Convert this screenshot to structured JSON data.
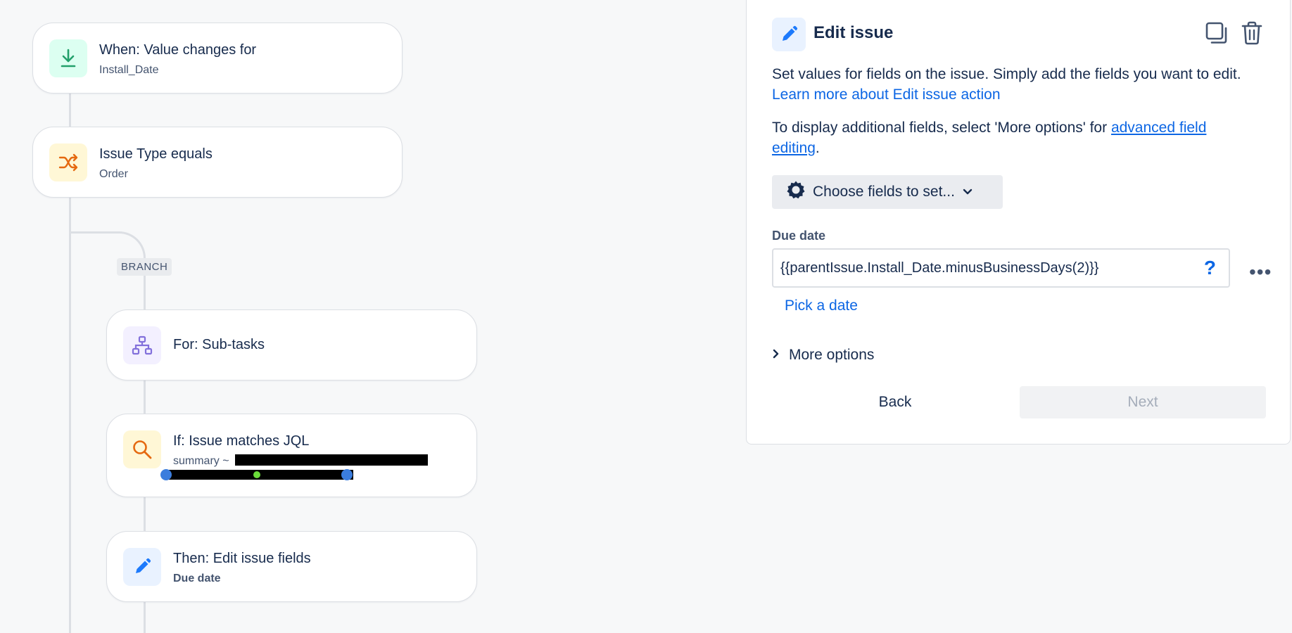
{
  "flow": {
    "trigger": {
      "title": "When: Value changes for",
      "subtitle": "Install_Date",
      "icon": "download-icon"
    },
    "condition": {
      "title": "Issue Type equals",
      "subtitle": "Order",
      "icon": "shuffle-icon"
    },
    "branch_label": "BRANCH",
    "for_each": {
      "title": "For: Sub-tasks",
      "icon": "hierarchy-icon"
    },
    "if_jql": {
      "title": "If: Issue matches JQL",
      "subtitle_prefix": "summary ~",
      "icon": "search-icon"
    },
    "then": {
      "title": "Then: Edit issue fields",
      "subtitle": "Due date",
      "icon": "pencil-icon"
    }
  },
  "panel": {
    "title": "Edit issue",
    "icon": "pencil-icon",
    "description": "Set values for fields on the issue. Simply add the fields you want to edit.",
    "learn_more_link": "Learn more about Edit issue action",
    "display_text": "To display additional fields, select 'More options' for",
    "advanced_link": "advanced field editing",
    "period": ".",
    "choose_fields_label": "Choose fields to set...",
    "field": {
      "label": "Due date",
      "value": "{{parentIssue.Install_Date.minusBusinessDays(2)}}",
      "help": "?"
    },
    "pick_date": "Pick a date",
    "more_options": "More options",
    "back_label": "Back",
    "next_label": "Next"
  },
  "colors": {
    "accent_blue": "#0c66e4",
    "trigger_bg": "#dcfff1",
    "trigger_fg": "#22a06b",
    "condition_bg": "#fff7d6",
    "condition_fg": "#e56910",
    "branch_bg": "#f3f0ff",
    "branch_fg": "#8270db",
    "action_bg": "#e9f2ff"
  }
}
